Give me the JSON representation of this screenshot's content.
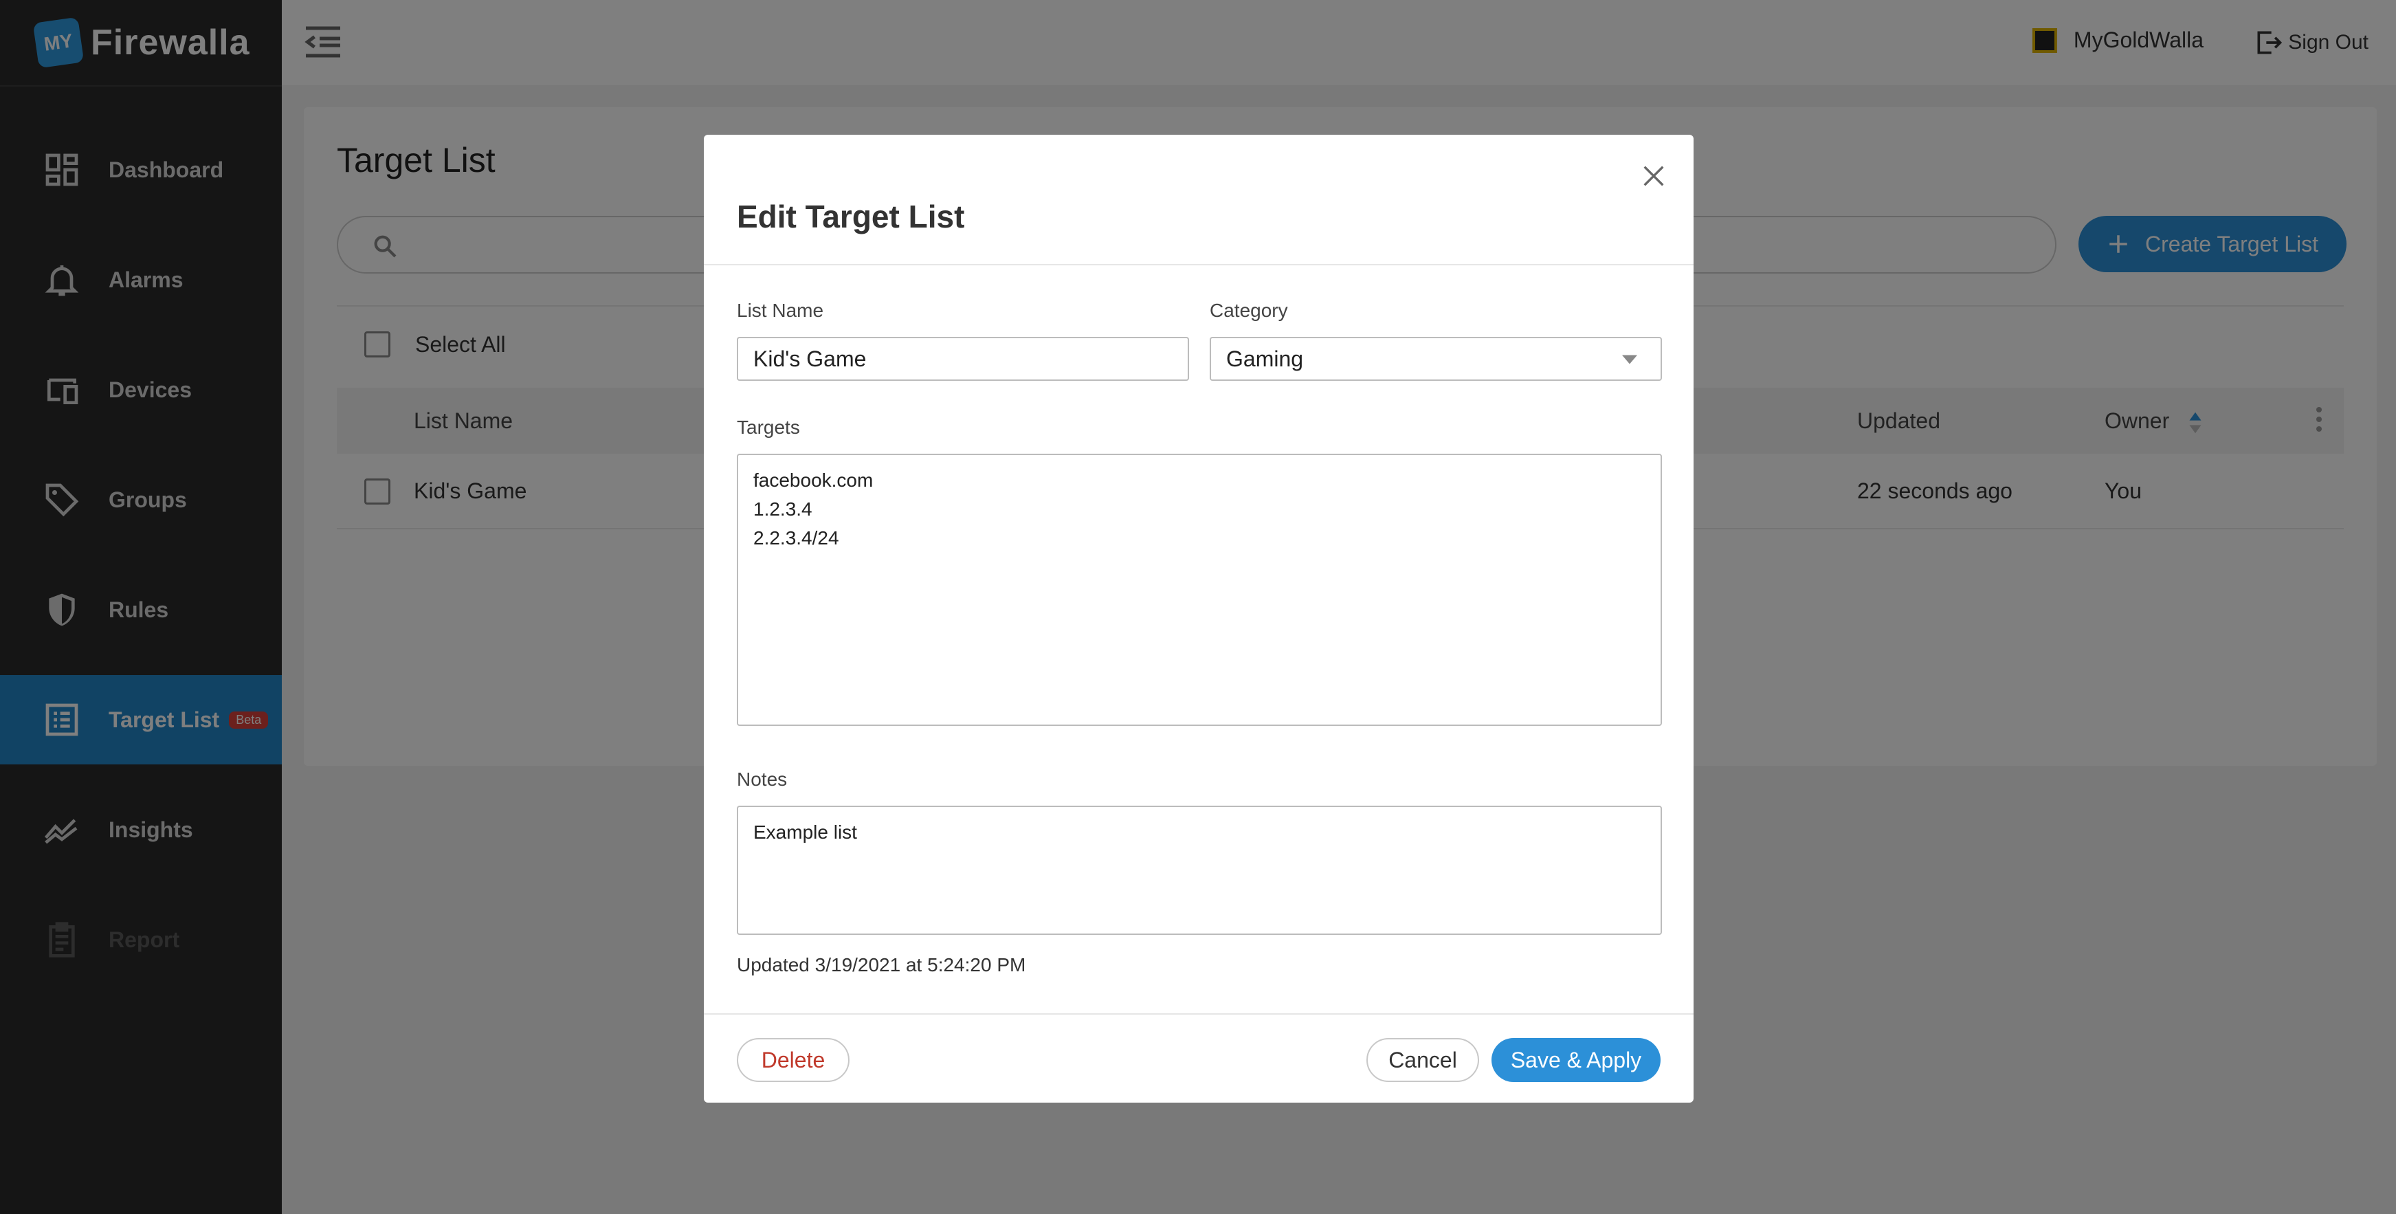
{
  "brand": {
    "badge": "MY",
    "name": "Firewalla"
  },
  "sidebar": {
    "items": [
      {
        "label": "Dashboard",
        "icon": "dashboard-icon"
      },
      {
        "label": "Alarms",
        "icon": "bell-icon"
      },
      {
        "label": "Devices",
        "icon": "devices-icon"
      },
      {
        "label": "Groups",
        "icon": "tag-icon"
      },
      {
        "label": "Rules",
        "icon": "shield-icon"
      },
      {
        "label": "Target List",
        "icon": "list-icon",
        "badge": "Beta",
        "active": true
      },
      {
        "label": "Insights",
        "icon": "trend-icon"
      },
      {
        "label": "Report",
        "icon": "clipboard-icon",
        "disabled": true
      }
    ]
  },
  "topbar": {
    "account_name": "MyGoldWalla",
    "sign_out": "Sign Out"
  },
  "page": {
    "title": "Target List",
    "search_placeholder": "",
    "create_button": "Create Target List",
    "select_all": "Select All",
    "columns": [
      "List Name",
      "Updated",
      "Owner"
    ],
    "rows": [
      {
        "name": "Kid's Game",
        "updated": "22 seconds ago",
        "owner": "You"
      }
    ]
  },
  "modal": {
    "title": "Edit Target List",
    "list_name_label": "List Name",
    "list_name_value": "Kid's Game",
    "category_label": "Category",
    "category_value": "Gaming",
    "targets_label": "Targets",
    "targets": [
      "facebook.com",
      "1.2.3.4",
      "2.2.3.4/24"
    ],
    "notes_label": "Notes",
    "notes_value": "Example list",
    "updated_text": "Updated 3/19/2021 at 5:24:20 PM",
    "delete_button": "Delete",
    "cancel_button": "Cancel",
    "save_button": "Save & Apply"
  },
  "colors": {
    "accent": "#2c90d8",
    "sidebar_bg": "#2b2b2b",
    "active_item": "#2386c9",
    "danger": "#c0392b",
    "beta_badge": "#d8403a"
  }
}
